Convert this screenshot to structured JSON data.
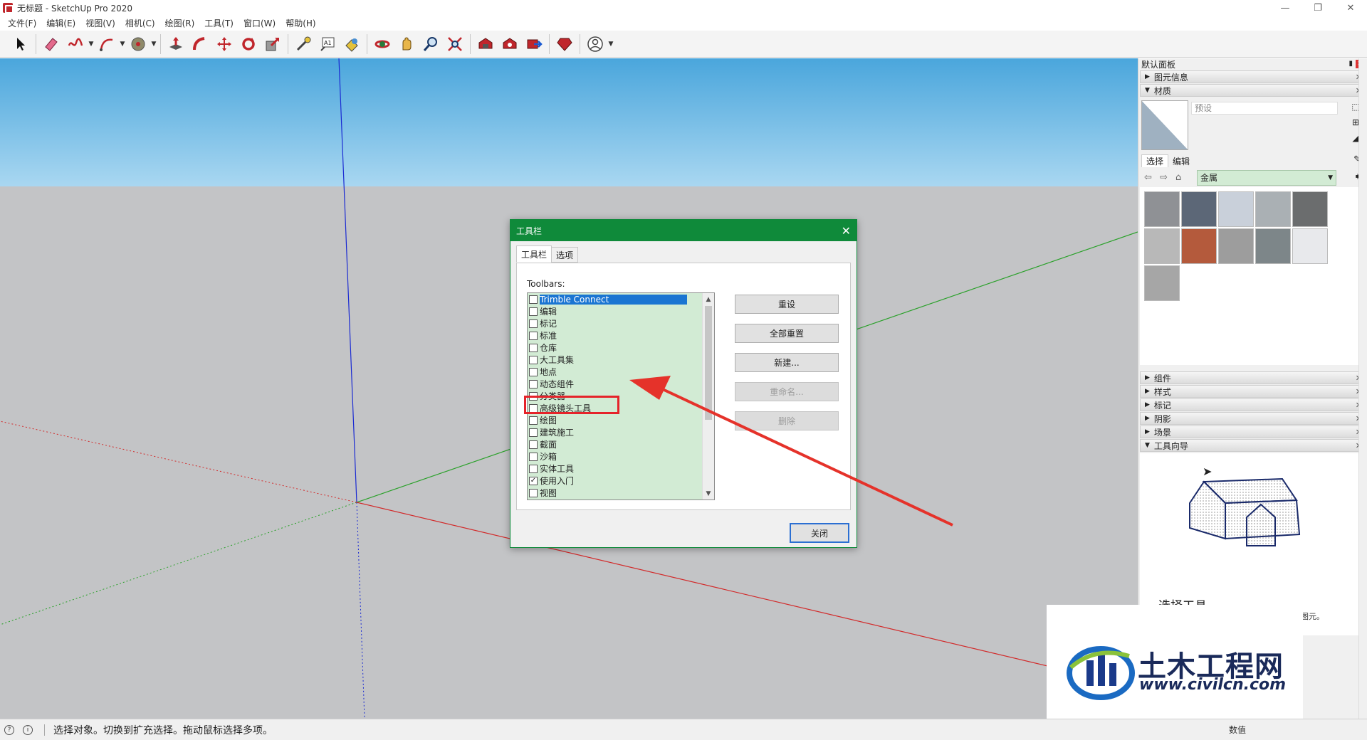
{
  "window": {
    "title": "无标题 - SketchUp Pro 2020",
    "controls": [
      "—",
      "❐",
      "✕"
    ]
  },
  "menu": [
    "文件(F)",
    "编辑(E)",
    "视图(V)",
    "相机(C)",
    "绘图(R)",
    "工具(T)",
    "窗口(W)",
    "帮助(H)"
  ],
  "toolbar": {
    "icons": [
      "select-icon",
      "eraser-icon",
      "freehand-icon",
      "arc-icon",
      "paint-bucket-icon",
      "push-pull-icon",
      "follow-me-icon",
      "move-icon",
      "rotate-icon",
      "scale-icon",
      "tape-measure-icon",
      "text-icon",
      "paint-icon",
      "orbit-icon",
      "pan-icon",
      "zoom-icon",
      "zoom-extents-icon",
      "warehouse-icon",
      "extension-icon",
      "share-icon",
      "ruby-icon",
      "account-icon"
    ]
  },
  "dialog": {
    "title": "工具栏",
    "tabs": [
      "工具栏",
      "选项"
    ],
    "toolbars_label": "Toolbars:",
    "items": [
      {
        "label": "Trimble Connect",
        "checked": false,
        "selected": true
      },
      {
        "label": "编辑",
        "checked": false
      },
      {
        "label": "标记",
        "checked": false
      },
      {
        "label": "标准",
        "checked": false
      },
      {
        "label": "仓库",
        "checked": false
      },
      {
        "label": "大工具集",
        "checked": false
      },
      {
        "label": "地点",
        "checked": false
      },
      {
        "label": "动态组件",
        "checked": false
      },
      {
        "label": "分类器",
        "checked": false
      },
      {
        "label": "高级镜头工具",
        "checked": false
      },
      {
        "label": "绘图",
        "checked": false
      },
      {
        "label": "建筑施工",
        "checked": false
      },
      {
        "label": "截面",
        "checked": false
      },
      {
        "label": "沙箱",
        "checked": false
      },
      {
        "label": "实体工具",
        "checked": false
      },
      {
        "label": "使用入门",
        "checked": true
      },
      {
        "label": "视图",
        "checked": false
      }
    ],
    "buttons": {
      "reset": "重设",
      "reset_all": "全部重置",
      "new": "新建...",
      "rename": "重命名...",
      "delete": "删除",
      "close": "关闭"
    }
  },
  "panel": {
    "title": "默认面板",
    "sections_top": [
      {
        "label": "图元信息",
        "expanded": false
      },
      {
        "label": "材质",
        "expanded": true
      }
    ],
    "material": {
      "name_placeholder": "预设",
      "tabs": [
        "选择",
        "编辑"
      ],
      "category": "金属",
      "swatch_colors": [
        "#8f9195",
        "#5c6777",
        "#c9d0da",
        "#aab0b4",
        "#6b6d6e",
        "#b8b8b8",
        "#b45a3c",
        "#9d9d9d",
        "#7d8689",
        "#e8e9ec",
        "#a6a6a6"
      ]
    },
    "sections_bottom": [
      {
        "label": "组件",
        "expanded": false
      },
      {
        "label": "样式",
        "expanded": false
      },
      {
        "label": "标记",
        "expanded": false
      },
      {
        "label": "阴影",
        "expanded": false
      },
      {
        "label": "场景",
        "expanded": false
      },
      {
        "label": "工具向导",
        "expanded": true
      }
    ],
    "guide": {
      "title": "选择工具",
      "text": "在使用其他工具或命令时，选择要修改的图元。"
    }
  },
  "status": {
    "text": "选择对象。切换到扩充选择。拖动鼠标选择多项。",
    "measure_label": "数值"
  },
  "watermark": {
    "name": "土木工程网",
    "url": "www.civilcn.com"
  }
}
